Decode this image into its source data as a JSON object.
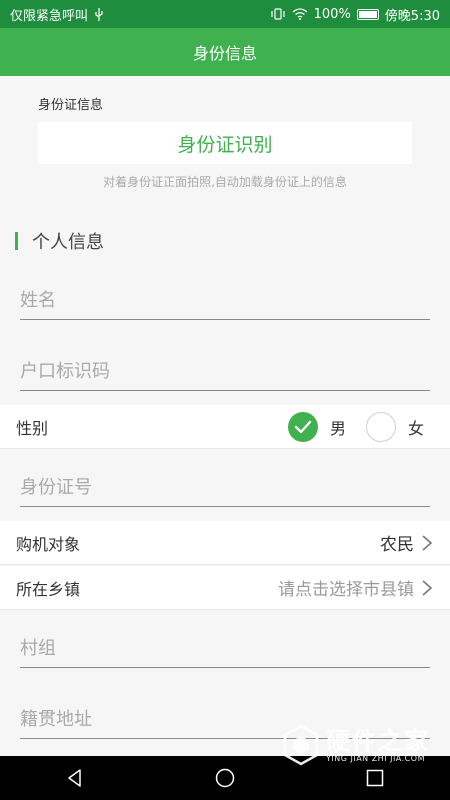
{
  "status_bar": {
    "carrier": "仅限紧急呼叫",
    "battery_percent": "100%",
    "time": "傍晚5:30"
  },
  "header": {
    "title": "身份信息"
  },
  "id_card": {
    "section_label": "身份证信息",
    "button_label": "身份证识别",
    "hint": "对着身份证正面拍照,自动加载身份证上的信息"
  },
  "personal": {
    "title": "个人信息",
    "name_placeholder": "姓名",
    "household_placeholder": "户口标识码",
    "gender_label": "性别",
    "gender_male": "男",
    "gender_female": "女",
    "gender_selected": "男",
    "id_number_placeholder": "身份证号",
    "buyer_label": "购机对象",
    "buyer_value": "农民",
    "township_label": "所在乡镇",
    "township_placeholder": "请点击选择市县镇",
    "village_placeholder": "村组",
    "native_address_placeholder": "籍贯地址"
  },
  "watermark": {
    "main": "硬件之家",
    "sub": "YING JIAN ZHI JIA.COM"
  },
  "colors": {
    "accent": "#3fb24f",
    "status_bar": "#1e8e3e",
    "background": "#f6f6f6"
  },
  "icons": [
    "usb-icon",
    "vibrate-icon",
    "wifi-icon",
    "battery-icon",
    "check-icon",
    "chevron-right-icon",
    "back-icon",
    "home-icon",
    "recent-apps-icon"
  ]
}
